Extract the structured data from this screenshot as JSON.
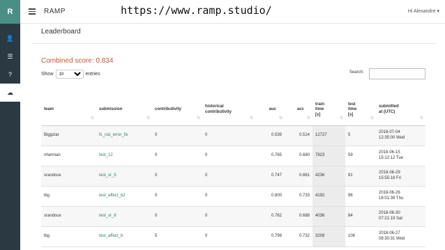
{
  "app": {
    "brand": "RAMP",
    "url_overlay": "https://www.ramp.studio/",
    "user": "Hi Alexandre ▾"
  },
  "sidebar": {
    "logo": "R",
    "items": [
      {
        "icon": "user-plus-icon",
        "glyph": "👤"
      },
      {
        "icon": "list-icon",
        "glyph": "☰"
      },
      {
        "icon": "help-icon",
        "glyph": "?"
      },
      {
        "icon": "cloud-icon",
        "glyph": "☁"
      }
    ]
  },
  "page": {
    "title": "Leaderboard",
    "combined_score": "Combined score: 0.834"
  },
  "controls": {
    "show_label": "Show",
    "show_value": "10",
    "entries_label": "entries",
    "search_label": "Search:",
    "search_value": ""
  },
  "table": {
    "columns": [
      "team",
      "submission",
      "contributivity",
      "historical\ncontributivity",
      "auc",
      "acc",
      "train\ntime\n[s]",
      "test\ntime\n[s]",
      "submitted\nat (UTC)"
    ],
    "rows": [
      [
        "Biggzlar",
        "fc_nat_error_fix",
        "0",
        "0",
        "0.539",
        "0.514",
        "12727",
        "5",
        "2018-07-04\n12:35:00 Wed"
      ],
      [
        "nherman",
        "test_12",
        "0",
        "0",
        "0.765",
        "0.680",
        "7923",
        "59",
        "2018-06-15\n15:12:12 Tue"
      ],
      [
        "srandoux",
        "test_sr_5",
        "0",
        "0",
        "0.747",
        "0.661",
        "4236",
        "91",
        "2018-06-29\n15:55:18 Fri"
      ],
      [
        "lbg",
        "test_affect_b2",
        "0",
        "0",
        "0.800",
        "0.733",
        "4192",
        "96",
        "2018-06-26\n16:01:39 Thu"
      ],
      [
        "srandoux",
        "test_sr_6",
        "0",
        "0",
        "0.762",
        "0.688",
        "4036",
        "84",
        "2018-06-30\n07:21:19 Sat"
      ],
      [
        "lbg",
        "test_affect_b",
        "5",
        "0",
        "0.799",
        "0.732",
        "3208",
        "106",
        "2018-06-27\n08:30:31 Wed"
      ]
    ]
  }
}
